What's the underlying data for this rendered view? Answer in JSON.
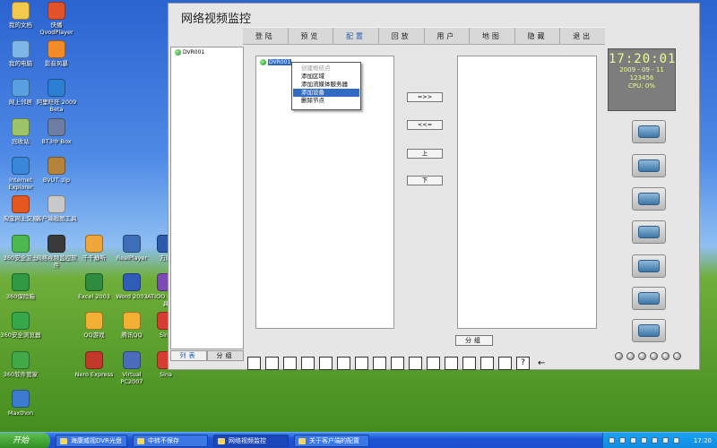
{
  "app": {
    "title": "网络视频监控",
    "menu": [
      "登陆",
      "预览",
      "配置",
      "回放",
      "用户",
      "地图",
      "隐藏",
      "退出"
    ],
    "active_menu_index": 2,
    "tree_root": "DVR001",
    "selected_node": "DVR001",
    "context_menu": {
      "items": [
        "创建根结点",
        "添加区域",
        "添加流媒体服务器",
        "添加设备",
        "删除节点"
      ],
      "disabled_index": 0,
      "highlighted_index": 3
    },
    "transfer_buttons": [
      "=>>",
      "<<=",
      "上",
      "下"
    ],
    "group_button": "分组",
    "left_tabs": [
      "列表",
      "分组"
    ],
    "active_tab_index": 0,
    "layout_icons": [
      "layout-1",
      "layout-4",
      "layout-6",
      "layout-8",
      "layout-9",
      "layout-16",
      "layout-1-5",
      "layout-1-7",
      "layout-center",
      "layout-1-12",
      "layout-2-8",
      "layout-3-6",
      "layout-13",
      "layout-20",
      "layout-25"
    ],
    "help_label": "?",
    "back_arrow": "←",
    "clock": {
      "time": "17:20:01",
      "date": "2009 - 09 - 11",
      "code": "123456",
      "cpu": "CPU:  0%"
    },
    "side_buttons": [
      "camera-button",
      "monitor-button",
      "device-button",
      "shield-button",
      "search-button",
      "map-button",
      "exit-button"
    ]
  },
  "desktop_icons": [
    {
      "label": "我的文档",
      "color": "#f2c94c"
    },
    {
      "label": "快播 QvodPlayer",
      "color": "#e0522a"
    },
    {
      "label": "我的电脑",
      "color": "#7fb6e8"
    },
    {
      "label": "影音风暴",
      "color": "#f28c28"
    },
    {
      "label": "网上邻居",
      "color": "#5aa0e0"
    },
    {
      "label": "阿里旺旺 2009 Beta",
      "color": "#2d7fd3"
    },
    {
      "label": "回收站",
      "color": "#9ec46a"
    },
    {
      "label": "BT3中 Box",
      "color": "#6e7ea3"
    },
    {
      "label": "Internet Explorer",
      "color": "#3a86d8"
    },
    {
      "label": "BVUT. zip",
      "color": "#b5843c"
    },
    {
      "label": "淘宝网上交易",
      "color": "#e6561f"
    },
    {
      "label": "客户端截图工具",
      "color": "#c9c9c9"
    },
    {
      "label": "360安全卫士",
      "color": "#4db84d"
    },
    {
      "label": "网络视频监控软件",
      "color": "#3a3a3a"
    },
    {
      "label": "千千静听",
      "color": "#f0a53a"
    },
    {
      "label": "RealPlayer",
      "color": "#3d6fb8"
    },
    {
      "label": "万能",
      "color": "#2c59a8"
    },
    {
      "label": "360保险箱",
      "color": "#2f9a43"
    },
    {
      "label": "Excel 2003",
      "color": "#2f8b3e"
    },
    {
      "label": "Word 2003",
      "color": "#2e5cb8"
    },
    {
      "label": "ATIOO 截图工具",
      "color": "#7b4bb3"
    },
    {
      "label": "360安全浏览器",
      "color": "#36a74a"
    },
    {
      "label": "QQ游戏",
      "color": "#f2b134"
    },
    {
      "label": "腾讯QQ",
      "color": "#f2b134"
    },
    {
      "label": "Sina",
      "color": "#d43d2f"
    },
    {
      "label": "360软件管家",
      "color": "#42a948"
    },
    {
      "label": "Nero Express",
      "color": "#c0392b"
    },
    {
      "label": "Virtual PC2007",
      "color": "#4b6cb8"
    },
    {
      "label": "Sina",
      "color": "#d43d2f"
    },
    {
      "label": "Maxthon",
      "color": "#3b7bd0"
    }
  ],
  "taskbar": {
    "start_label": "开始",
    "tasks": [
      "海康威视DVR光盘",
      "中转不保存",
      "网络视频监控",
      "关于客户端的配置"
    ],
    "active_task_index": 2,
    "time": "17:20"
  }
}
